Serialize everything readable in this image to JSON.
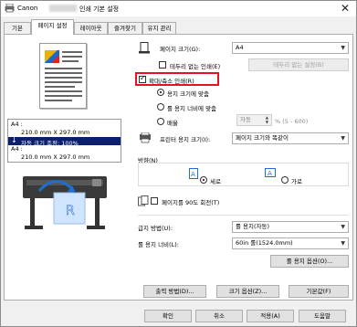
{
  "window": {
    "title_prefix": "Canon",
    "title_suffix": "인쇄 기본 설정",
    "close_glyph": "✕"
  },
  "tabs": [
    {
      "label": "기본"
    },
    {
      "label": "페이지 설정"
    },
    {
      "label": "레이아웃"
    },
    {
      "label": "즐겨찾기"
    },
    {
      "label": "유지 관리"
    }
  ],
  "preview": {
    "info_line1": "A4 :",
    "info_line2": "210.0 mm X 297.0 mm",
    "banner": "자동 크기 조정: 100%",
    "info_line3": "A4 :",
    "info_line4": "210.0 mm X 297.0 mm",
    "printer_letter": "R"
  },
  "page_size": {
    "label": "페이지 크기(G):",
    "value": "A4"
  },
  "borderless": {
    "label": "테두리 없는 인쇄(E)",
    "button": "테두리 없는 설정(B)"
  },
  "scaled": {
    "label": "확대/축소 인쇄(R)"
  },
  "scale_options": {
    "fit_paper": "용지 크기에 맞춤",
    "fit_roll": "롤 용지 너비에 맞춤",
    "scale": "배율",
    "scale_value": "자동",
    "scale_range": "% (5 - 600)"
  },
  "printer_paper": {
    "label": "프린터 용지 크기(I):",
    "value": "페이지 크기와 똑같이"
  },
  "orientation": {
    "group_label": "방향(N)",
    "portrait": "세로",
    "landscape": "가로"
  },
  "rotate": {
    "label": "페이지를 90도 회전(T)"
  },
  "paper_source": {
    "label": "급지 방법(U):",
    "value": "롤 용지(자동)"
  },
  "roll_width": {
    "label": "롤 용지 너비(L):",
    "value": "60in 롤(1524.0mm)"
  },
  "roll_options": {
    "label": "롤 용지 옵션(O)..."
  },
  "bottom_row": {
    "output": "출력 방법(D)...",
    "size_options": "크기 옵션(Z)...",
    "defaults": "기본값(F)"
  },
  "footer": {
    "ok": "확인",
    "cancel": "취소",
    "apply": "적용(A)",
    "help": "도움말"
  },
  "colors": {
    "highlight": "#e81123",
    "banner": "#0b1f6e",
    "accent": "#1e6fd0"
  }
}
